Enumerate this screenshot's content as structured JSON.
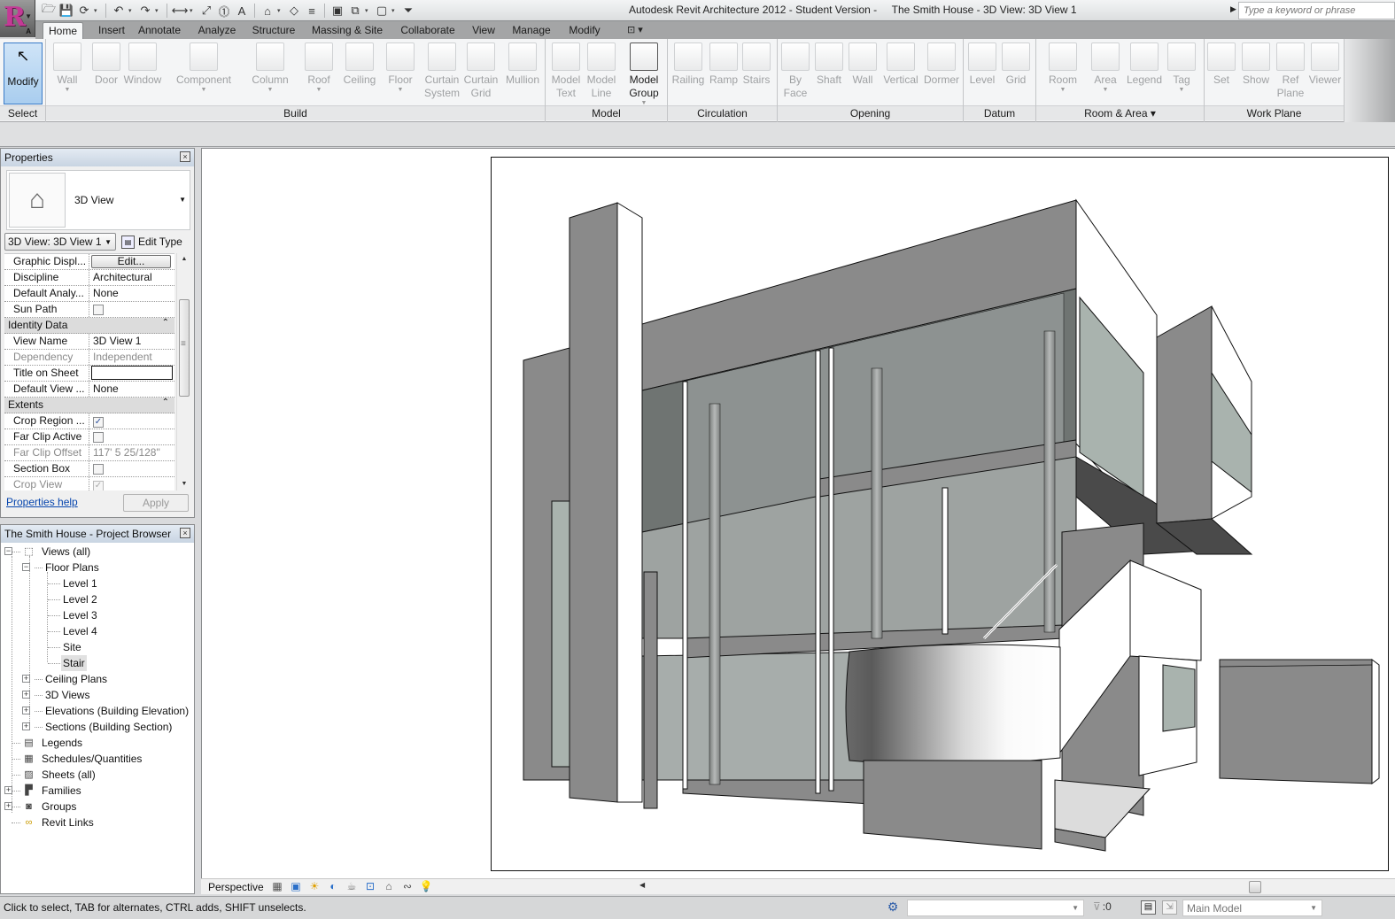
{
  "app": {
    "title": "Autodesk Revit Architecture 2012 - Student Version -     The Smith House - 3D View: 3D View 1",
    "logo_letter": "R",
    "search_placeholder": "Type a keyword or phrase"
  },
  "quick_access": [
    {
      "name": "open-icon",
      "glyph": "🗁"
    },
    {
      "name": "save-icon",
      "glyph": "💾"
    },
    {
      "name": "sync-icon",
      "glyph": "⟳"
    },
    {
      "name": "undo-icon",
      "glyph": "↶"
    },
    {
      "name": "redo-icon",
      "glyph": "↷"
    },
    {
      "name": "measure-icon",
      "glyph": "⟷"
    },
    {
      "name": "aligned-dimension-icon",
      "glyph": "⤢"
    },
    {
      "name": "tag-icon",
      "glyph": "⓵"
    },
    {
      "name": "text-icon",
      "glyph": "A"
    },
    {
      "name": "default-3d-view-icon",
      "glyph": "⌂"
    },
    {
      "name": "section-icon",
      "glyph": "◇"
    },
    {
      "name": "thin-lines-icon",
      "glyph": "≡"
    },
    {
      "name": "close-hidden-windows-icon",
      "glyph": "▣"
    },
    {
      "name": "switch-windows-icon",
      "glyph": "⧉"
    },
    {
      "name": "custom-icon",
      "glyph": "▢"
    }
  ],
  "tabs": [
    {
      "label": "Home",
      "active": true
    },
    {
      "label": "Insert"
    },
    {
      "label": "Annotate"
    },
    {
      "label": "Analyze"
    },
    {
      "label": "Structure"
    },
    {
      "label": "Massing & Site"
    },
    {
      "label": "Collaborate"
    },
    {
      "label": "View"
    },
    {
      "label": "Manage"
    },
    {
      "label": "Modify"
    }
  ],
  "ribbon": {
    "select": {
      "label": "Select",
      "modify": "Modify"
    },
    "panels": [
      {
        "label": "Build",
        "buttons": [
          {
            "label": "Wall",
            "dd": true
          },
          {
            "label": "Door"
          },
          {
            "label": "Window"
          },
          {
            "label": "Component",
            "dd": true
          },
          {
            "label": "Column",
            "dd": true
          },
          {
            "label": "Roof",
            "dd": true
          },
          {
            "label": "Ceiling"
          },
          {
            "label": "Floor",
            "dd": true
          },
          {
            "label": "Curtain\nSystem"
          },
          {
            "label": "Curtain\nGrid"
          },
          {
            "label": "Mullion"
          }
        ]
      },
      {
        "label": "Model",
        "buttons": [
          {
            "label": "Model\nText"
          },
          {
            "label": "Model\nLine"
          },
          {
            "label": "Model\nGroup",
            "enabled": true,
            "dd": true
          }
        ]
      },
      {
        "label": "Circulation",
        "buttons": [
          {
            "label": "Railing"
          },
          {
            "label": "Ramp"
          },
          {
            "label": "Stairs"
          }
        ]
      },
      {
        "label": "Opening",
        "buttons": [
          {
            "label": "By\nFace"
          },
          {
            "label": "Shaft"
          },
          {
            "label": "Wall"
          },
          {
            "label": "Vertical"
          },
          {
            "label": "Dormer"
          }
        ]
      },
      {
        "label": "Datum",
        "buttons": [
          {
            "label": "Level"
          },
          {
            "label": "Grid"
          }
        ]
      },
      {
        "label": "Room & Area ▾",
        "buttons": [
          {
            "label": "Room",
            "dd": true
          },
          {
            "label": "Area",
            "dd": true
          },
          {
            "label": "Legend"
          },
          {
            "label": "Tag",
            "dd": true
          }
        ]
      },
      {
        "label": "Work Plane",
        "buttons": [
          {
            "label": "Set"
          },
          {
            "label": "Show"
          },
          {
            "label": "Ref\nPlane"
          },
          {
            "label": "Viewer"
          }
        ]
      }
    ]
  },
  "properties": {
    "title": "Properties",
    "type_name": "3D View",
    "instance_selector": "3D View: 3D View 1",
    "edit_type": "Edit Type",
    "rows": [
      {
        "key": "Graphic Displ...",
        "value": "Edit...",
        "kind": "button"
      },
      {
        "key": "Discipline",
        "value": "Architectural"
      },
      {
        "key": "Default Analy...",
        "value": "None"
      },
      {
        "key": "Sun Path",
        "kind": "checkbox",
        "checked": false
      },
      {
        "group": "Identity Data"
      },
      {
        "key": "View Name",
        "value": "3D View 1"
      },
      {
        "key": "Dependency",
        "value": "Independent",
        "dim": true
      },
      {
        "key": "Title on Sheet",
        "value": "",
        "kind": "text"
      },
      {
        "key": "Default View ...",
        "value": "None"
      },
      {
        "group": "Extents"
      },
      {
        "key": "Crop Region ...",
        "kind": "checkbox",
        "checked": true
      },
      {
        "key": "Far Clip Active",
        "kind": "checkbox",
        "checked": false
      },
      {
        "key": "Far Clip Offset",
        "value": "117'  5 25/128\"",
        "dim": true
      },
      {
        "key": "Section Box",
        "kind": "checkbox",
        "checked": false
      },
      {
        "key": "Crop View",
        "kind": "checkbox",
        "checked": true,
        "dim": true
      }
    ],
    "help_link": "Properties help",
    "apply": "Apply"
  },
  "browser": {
    "title": "The Smith House - Project Browser",
    "nodes": [
      {
        "label": "Views (all)",
        "level": 0,
        "exp": "-",
        "icon": "views-icon",
        "glyph": "⬚"
      },
      {
        "label": "Floor Plans",
        "level": 1,
        "exp": "-"
      },
      {
        "label": "Level 1",
        "level": 2
      },
      {
        "label": "Level 2",
        "level": 2
      },
      {
        "label": "Level 3",
        "level": 2
      },
      {
        "label": "Level 4",
        "level": 2
      },
      {
        "label": "Site",
        "level": 2
      },
      {
        "label": "Stair",
        "level": 2,
        "selected": true
      },
      {
        "label": "Ceiling Plans",
        "level": 1,
        "exp": "+"
      },
      {
        "label": "3D Views",
        "level": 1,
        "exp": "+"
      },
      {
        "label": "Elevations (Building Elevation)",
        "level": 1,
        "exp": "+"
      },
      {
        "label": "Sections (Building Section)",
        "level": 1,
        "exp": "+"
      },
      {
        "label": "Legends",
        "level": 0,
        "icon": "legends-icon",
        "glyph": "▤"
      },
      {
        "label": "Schedules/Quantities",
        "level": 0,
        "icon": "schedules-icon",
        "glyph": "▦"
      },
      {
        "label": "Sheets (all)",
        "level": 0,
        "icon": "sheets-icon",
        "glyph": "▨"
      },
      {
        "label": "Families",
        "level": 0,
        "exp": "+",
        "icon": "families-icon",
        "glyph": "▛"
      },
      {
        "label": "Groups",
        "level": 0,
        "exp": "+",
        "icon": "groups-icon",
        "glyph": "◙"
      },
      {
        "label": "Revit Links",
        "level": 0,
        "icon": "revit-links-icon",
        "glyph": "∞"
      }
    ]
  },
  "view_control": {
    "scale": "Perspective",
    "icons": [
      {
        "name": "detail-level-icon",
        "glyph": "▦",
        "color": "#555555"
      },
      {
        "name": "visual-style-icon",
        "glyph": "▣",
        "color": "#2a6fc9"
      },
      {
        "name": "sun-path-off-icon",
        "glyph": "☀",
        "color": "#e0a000"
      },
      {
        "name": "shadows-off-icon",
        "glyph": "◐",
        "color": "#2a6fc9"
      },
      {
        "name": "render-icon",
        "glyph": "☕",
        "color": "#777777"
      },
      {
        "name": "crop-view-icon",
        "glyph": "⊡",
        "color": "#2a6fc9"
      },
      {
        "name": "lock-3d-view-icon",
        "glyph": "⌂",
        "color": "#555555"
      },
      {
        "name": "temporary-hide-icon",
        "glyph": "∾",
        "color": "#555555"
      },
      {
        "name": "reveal-hidden-icon",
        "glyph": "💡",
        "color": "#2a6fc9"
      }
    ]
  },
  "status": {
    "message": "Click to select, TAB for alternates, CTRL adds, SHIFT unselects.",
    "workset": "",
    "filter_count": ":0",
    "design_option": "Main Model"
  },
  "palette": {
    "wall_mid": "#8a8a8a",
    "wall_dark": "#4a4a4a",
    "glass": "#a9b3ae",
    "interior": "#6f7472"
  }
}
